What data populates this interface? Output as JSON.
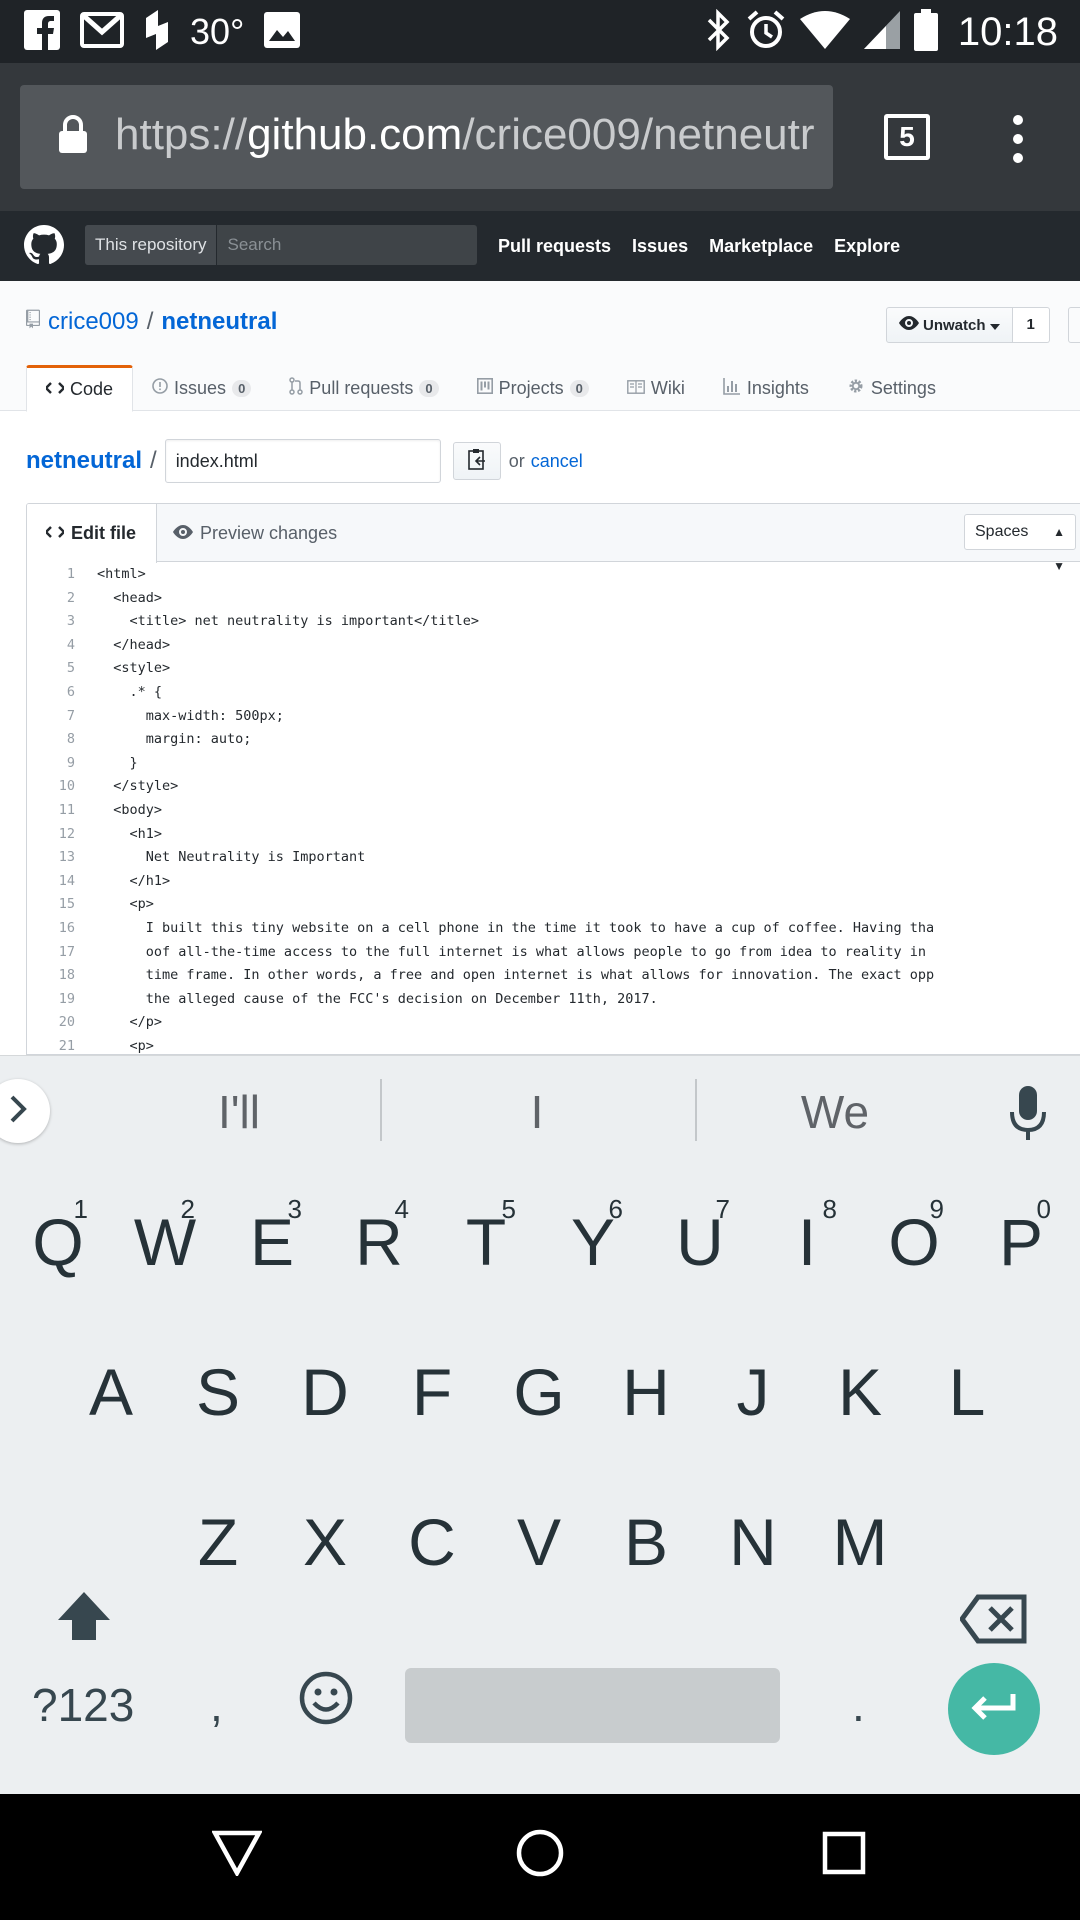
{
  "status_bar": {
    "temperature": "30°",
    "time": "10:18",
    "notification_icons": [
      "facebook-icon",
      "gmail-icon",
      "app-icon",
      "image-icon"
    ],
    "system_icons": [
      "bluetooth-icon",
      "alarm-icon",
      "wifi-icon",
      "signal-icon",
      "battery-icon"
    ]
  },
  "browser": {
    "url_scheme": "https://",
    "url_host": "github.com",
    "url_path": "/crice009/netneutr",
    "tab_count": "5"
  },
  "gh_header": {
    "search_scope": "This repository",
    "search_placeholder": "Search",
    "nav": [
      "Pull requests",
      "Issues",
      "Marketplace",
      "Explore"
    ]
  },
  "repo": {
    "owner": "crice009",
    "separator": "/",
    "name": "netneutral",
    "watch_label": "Unwatch",
    "watch_count": "1",
    "tabs": [
      {
        "label": "Code",
        "count": ""
      },
      {
        "label": "Issues",
        "count": "0"
      },
      {
        "label": "Pull requests",
        "count": "0"
      },
      {
        "label": "Projects",
        "count": "0"
      },
      {
        "label": "Wiki",
        "count": ""
      },
      {
        "label": "Insights",
        "count": ""
      },
      {
        "label": "Settings",
        "count": ""
      }
    ]
  },
  "editor": {
    "repo_link": "netneutral",
    "slash": "/",
    "filename": "index.html",
    "or_text": "or",
    "cancel_text": "cancel",
    "edit_tab": "Edit file",
    "preview_tab": "Preview changes",
    "indent_mode": "Spaces",
    "lines": [
      {
        "n": "1",
        "text": "<html>"
      },
      {
        "n": "2",
        "text": "  <head>"
      },
      {
        "n": "3",
        "text": "    <title> net neutrality is important</title>"
      },
      {
        "n": "4",
        "text": "  </head>"
      },
      {
        "n": "5",
        "text": "  <style>"
      },
      {
        "n": "6",
        "text": "    .* {"
      },
      {
        "n": "7",
        "text": "      max-width: 500px;"
      },
      {
        "n": "8",
        "text": "      margin: auto;"
      },
      {
        "n": "9",
        "text": "    }"
      },
      {
        "n": "10",
        "text": "  </style>"
      },
      {
        "n": "11",
        "text": "  <body>"
      },
      {
        "n": "12",
        "text": "    <h1>"
      },
      {
        "n": "13",
        "text": "      Net Neutrality is Important"
      },
      {
        "n": "14",
        "text": "    </h1>"
      },
      {
        "n": "15",
        "text": "    <p>"
      },
      {
        "n": "16",
        "text": "      I built this tiny website on a cell phone in the time it took to have a cup of coffee. Having tha"
      },
      {
        "n": "17",
        "text": "      oof all-the-time access to the full internet is what allows people to go from idea to reality in"
      },
      {
        "n": "18",
        "text": "      time frame. In other words, a free and open internet is what allows for innovation. The exact opp"
      },
      {
        "n": "19",
        "text": "      the alleged cause of the FCC's decision on December 11th, 2017."
      },
      {
        "n": "20",
        "text": "    </p>"
      },
      {
        "n": "21",
        "text": "    <p>"
      }
    ]
  },
  "keyboard": {
    "suggestions": [
      "I'll",
      "I",
      "We"
    ],
    "row1": [
      {
        "k": "Q",
        "h": "1"
      },
      {
        "k": "W",
        "h": "2"
      },
      {
        "k": "E",
        "h": "3"
      },
      {
        "k": "R",
        "h": "4"
      },
      {
        "k": "T",
        "h": "5"
      },
      {
        "k": "Y",
        "h": "6"
      },
      {
        "k": "U",
        "h": "7"
      },
      {
        "k": "I",
        "h": "8"
      },
      {
        "k": "O",
        "h": "9"
      },
      {
        "k": "P",
        "h": "0"
      }
    ],
    "row2": [
      "A",
      "S",
      "D",
      "F",
      "G",
      "H",
      "J",
      "K",
      "L"
    ],
    "row3": [
      "Z",
      "X",
      "C",
      "V",
      "B",
      "N",
      "M"
    ],
    "symbols_key": "?123",
    "comma_key": ",",
    "period_key": ".",
    "enter_color": "#45b8a5"
  },
  "colors": {
    "github_link": "#0366d6",
    "github_header": "#24292e",
    "selected_tab_accent": "#e36209"
  }
}
